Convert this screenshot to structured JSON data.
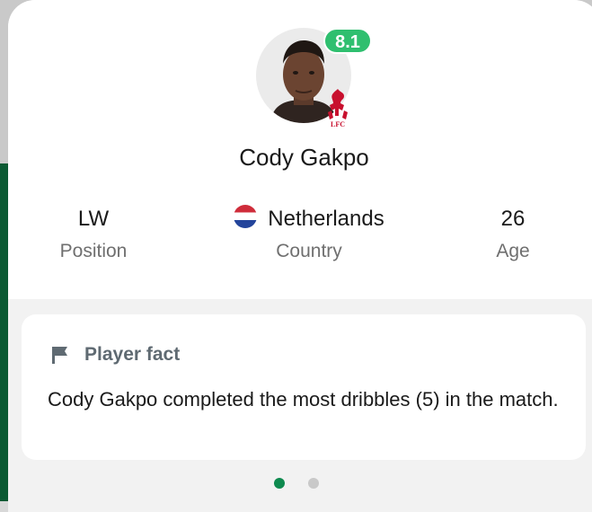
{
  "player": {
    "name": "Cody Gakpo",
    "rating": "8.1",
    "club_badge": "liverpool-crest"
  },
  "stats": {
    "position": {
      "value": "LW",
      "label": "Position"
    },
    "country": {
      "value": "Netherlands",
      "label": "Country",
      "flag": "netherlands-flag"
    },
    "age": {
      "value": "26",
      "label": "Age"
    }
  },
  "fact_card": {
    "title": "Player fact",
    "icon": "flag-icon",
    "text": "Cody Gakpo completed the most dribbles (5) in the match."
  },
  "pager": {
    "count": 2,
    "active_index": 0
  },
  "colors": {
    "rating_green": "#2fbf6f",
    "dot_active": "#0e8a4f",
    "dot_inactive": "#c9c9c9"
  }
}
